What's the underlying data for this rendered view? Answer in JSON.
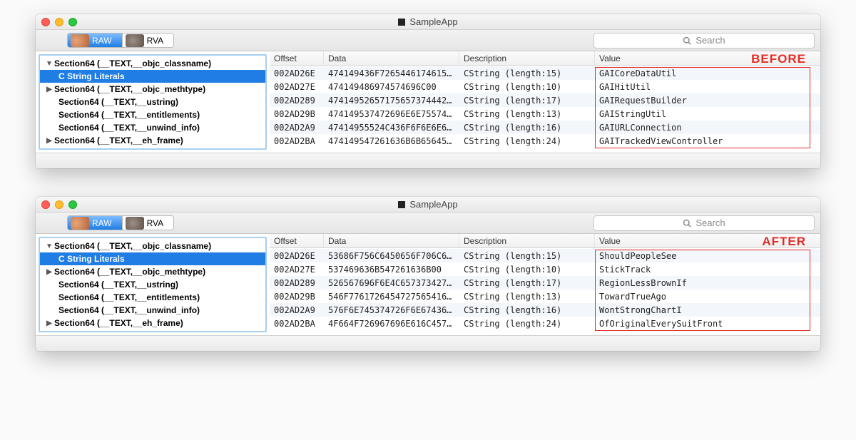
{
  "app": {
    "title": "SampleApp"
  },
  "toolbar": {
    "seg_raw": "RAW",
    "seg_rva": "RVA",
    "search_placeholder": "Search"
  },
  "sidebar": {
    "items": [
      {
        "disclosure": "▼",
        "label": "Section64 (__TEXT,__objc_classname)",
        "selected": false
      },
      {
        "disclosure": "",
        "label": "C String Literals",
        "selected": true,
        "indent": "grand"
      },
      {
        "disclosure": "▶",
        "label": "Section64 (__TEXT,__objc_methtype)"
      },
      {
        "disclosure": "",
        "label": "Section64 (__TEXT,__ustring)"
      },
      {
        "disclosure": "",
        "label": "Section64 (__TEXT,__entitlements)"
      },
      {
        "disclosure": "",
        "label": "Section64 (__TEXT,__unwind_info)"
      },
      {
        "disclosure": "▶",
        "label": "Section64 (__TEXT,__eh_frame)"
      }
    ]
  },
  "table": {
    "columns": {
      "offset": "Offset",
      "data": "Data",
      "desc": "Description",
      "value": "Value"
    }
  },
  "before": {
    "label": "BEFORE",
    "rows": [
      {
        "offset": "002AD26E",
        "data": "474149436F7265446174615…",
        "desc": "CString (length:15)",
        "value": "GAICoreDataUtil"
      },
      {
        "offset": "002AD27E",
        "data": "474149486974574696C00",
        "desc": "CString (length:10)",
        "value": "GAIHitUtil"
      },
      {
        "offset": "002AD289",
        "data": "474149526571756573744427…",
        "desc": "CString (length:17)",
        "value": "GAIRequestBuilder"
      },
      {
        "offset": "002AD29B",
        "data": "474149537472696E6E755746…",
        "desc": "CString (length:13)",
        "value": "GAIStringUtil"
      },
      {
        "offset": "002AD2A9",
        "data": "47414955524C436F6F6E6E656…",
        "desc": "CString (length:16)",
        "value": "GAIURLConnection"
      },
      {
        "offset": "002AD2BA",
        "data": "474149547261636B6B6564566…",
        "desc": "CString (length:24)",
        "value": "GAITrackedViewController"
      }
    ]
  },
  "after": {
    "label": "AFTER",
    "rows": [
      {
        "offset": "002AD26E",
        "data": "53686F756C6450656F706C6…",
        "desc": "CString (length:15)",
        "value": "ShouldPeopleSee"
      },
      {
        "offset": "002AD27E",
        "data": "537469636B547261636B00",
        "desc": "CString (length:10)",
        "value": "StickTrack"
      },
      {
        "offset": "002AD289",
        "data": "526567696F6E4C6573734272…",
        "desc": "CString (length:17)",
        "value": "RegionLessBrownIf"
      },
      {
        "offset": "002AD29B",
        "data": "546F7761726454727565416…",
        "desc": "CString (length:13)",
        "value": "TowardTrueAgo"
      },
      {
        "offset": "002AD2A9",
        "data": "576F6E745374726F6E67436…",
        "desc": "CString (length:16)",
        "value": "WontStrongChartI"
      },
      {
        "offset": "002AD2BA",
        "data": "4F664F726967696E616C4576…",
        "desc": "CString (length:24)",
        "value": "OfOriginalEverySuitFront"
      }
    ]
  }
}
